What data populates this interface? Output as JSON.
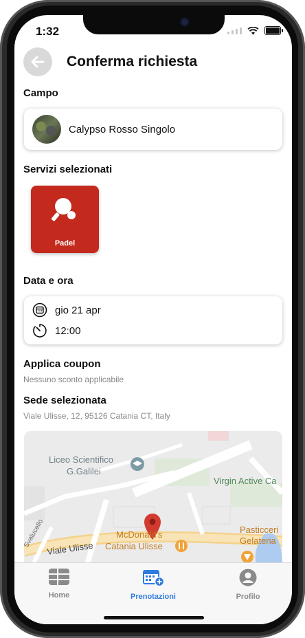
{
  "status_bar": {
    "time": "1:32"
  },
  "header": {
    "title": "Conferma richiesta"
  },
  "campo": {
    "label": "Campo",
    "field_name": "Calypso Rosso Singolo"
  },
  "servizi": {
    "label": "Servizi selezionati",
    "items": [
      {
        "label": "Padel",
        "icon": "racket-icon",
        "color": "#c4291d"
      }
    ]
  },
  "data_ora": {
    "label": "Data e ora",
    "date": "gio 21 apr",
    "time": "12:00"
  },
  "coupon": {
    "label": "Applica coupon",
    "message": "Nessuno sconto applicabile"
  },
  "sede": {
    "label": "Sede selezionata",
    "address": "Viale Ulisse, 12, 95126 Catania CT, Italy"
  },
  "map": {
    "labels": {
      "liceo_line1": "Liceo Scientifico",
      "liceo_line2": "G.Galilei",
      "virgin": "Virgin Active Ca",
      "viale": "Viale Ulisse",
      "mcd_line1": "McDonald's",
      "mcd_line2": "Catania Ulisse",
      "pasticceria": "Pasticceri",
      "gelateria": "Gelateria",
      "side_street": "Svalucello"
    }
  },
  "tabbar": {
    "tabs": [
      {
        "label": "Home",
        "icon": "grid-icon",
        "active": false
      },
      {
        "label": "Prenotazioni",
        "icon": "calendar-add-icon",
        "active": true
      },
      {
        "label": "Profilo",
        "icon": "user-icon",
        "active": false
      }
    ],
    "active_color": "#2f7be0",
    "inactive_color": "#8a8a8a"
  }
}
